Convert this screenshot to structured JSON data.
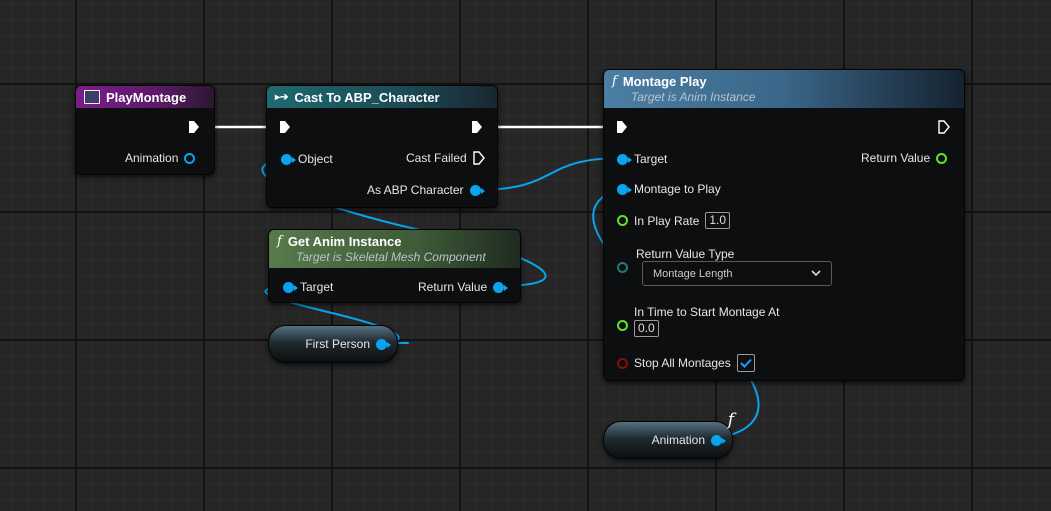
{
  "nodes": {
    "play_montage": {
      "title": "PlayMontage",
      "pins": {
        "animation": "Animation"
      }
    },
    "cast_to": {
      "title": "Cast To ABP_Character",
      "pins": {
        "object": "Object",
        "cast_failed": "Cast Failed",
        "as_abp_character": "As ABP Character"
      }
    },
    "get_anim_instance": {
      "title": "Get Anim Instance",
      "subtitle": "Target is Skeletal Mesh Component",
      "pins": {
        "target": "Target",
        "return_value": "Return Value"
      }
    },
    "first_person": {
      "label": "First Person"
    },
    "montage_play": {
      "title": "Montage Play",
      "subtitle": "Target is Anim Instance",
      "pins": {
        "target": "Target",
        "return_value": "Return Value",
        "montage_to_play": "Montage to Play",
        "in_play_rate": "In Play Rate",
        "in_play_rate_value": "1.0",
        "return_value_type": "Return Value Type",
        "return_value_type_selected": "Montage Length",
        "in_time_to_start": "In Time to Start Montage At",
        "in_time_to_start_value": "0.0",
        "stop_all_montages": "Stop All Montages",
        "stop_all_montages_checked": true
      }
    },
    "animation_var": {
      "label": "Animation"
    }
  },
  "icons": {
    "function": "f",
    "cast": "▸➔"
  },
  "colors": {
    "object_pin": "#0aa3ee",
    "float_pin": "#5fe22c",
    "bool_pin": "#8a0d0d",
    "enum_pin": "#1a7f78",
    "event_header": "#7b1d8a",
    "cast_header": "#1e6a70",
    "pure_function_header": "#587a4b",
    "function_header": "#4c7ea4"
  }
}
